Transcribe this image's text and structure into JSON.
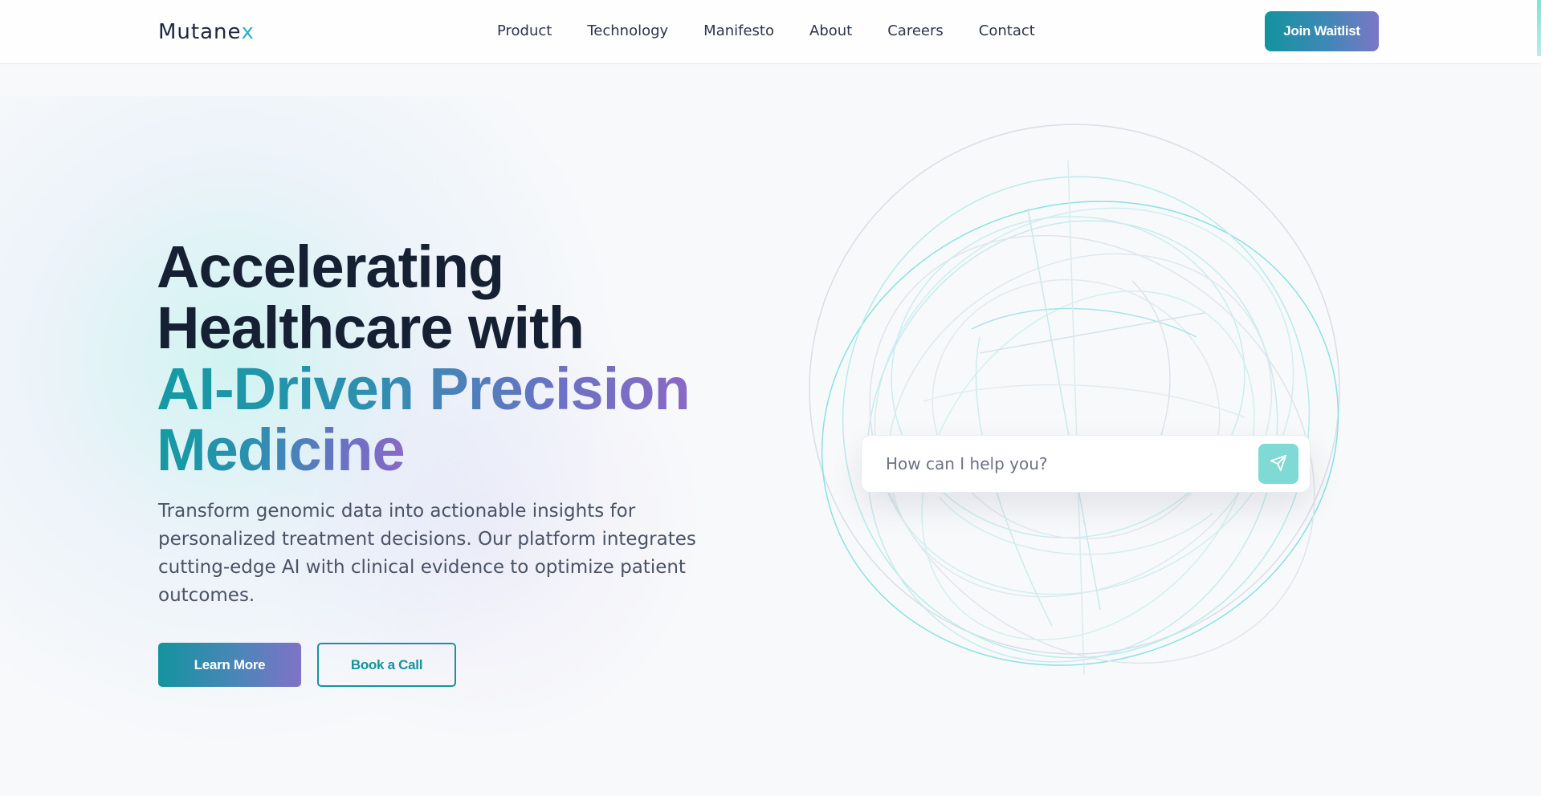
{
  "brand": {
    "logo_main": "Mutane",
    "logo_accent": "x"
  },
  "nav": {
    "items": [
      "Product",
      "Technology",
      "Manifesto",
      "About",
      "Careers",
      "Contact"
    ],
    "cta_label": "Join Waitlist"
  },
  "hero": {
    "title_line1": "Accelerating",
    "title_line2": "Healthcare with",
    "title_line3": "AI-Driven Precision",
    "title_line4": "Medicine",
    "description": "Transform genomic data into actionable insights for personalized treatment decisions. Our platform integrates cutting-edge AI with clinical evidence to optimize patient outcomes.",
    "primary_button": "Learn More",
    "secondary_button": "Book a Call"
  },
  "assistant": {
    "placeholder": "How can I help you?",
    "send_icon": "paper-plane-icon"
  },
  "colors": {
    "accent_teal": "#13939e",
    "accent_violet": "#7b77c7",
    "heading": "#162033",
    "send_button": "#7fd9d4"
  }
}
